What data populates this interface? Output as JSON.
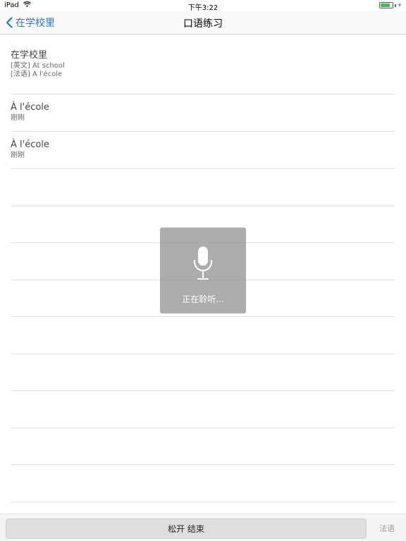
{
  "status_bar": {
    "device": "iPad",
    "time": "下午3:22",
    "battery_level": 0.8,
    "battery_color": "#3cc04a"
  },
  "nav": {
    "back_label": "在学校里",
    "title": "口语练习",
    "accent_color": "#1a7ae0"
  },
  "header_item": {
    "title": "在学校里",
    "english": "[英文] At school",
    "french": "[法语] A l'école"
  },
  "history": [
    {
      "text": "À l'école",
      "time": "刚刚"
    },
    {
      "text": "À l'école",
      "time": "刚刚"
    }
  ],
  "overlay": {
    "icon": "microphone-icon",
    "text": "正在聆听..."
  },
  "bottom": {
    "talk_button_label": "松开 结束",
    "language_label": "法语"
  }
}
